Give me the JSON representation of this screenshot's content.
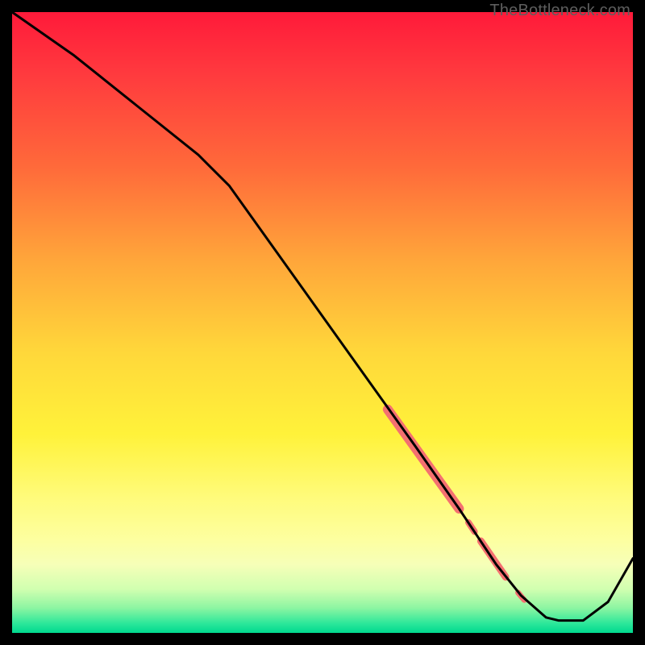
{
  "watermark": "TheBottleneck.com",
  "chart_data": {
    "type": "line",
    "title": "",
    "xlabel": "",
    "ylabel": "",
    "xlim": [
      0,
      100
    ],
    "ylim": [
      0,
      100
    ],
    "gradient_stops": [
      {
        "offset": 0.0,
        "color": "#ff1a3a"
      },
      {
        "offset": 0.1,
        "color": "#ff3a3e"
      },
      {
        "offset": 0.25,
        "color": "#ff6a3a"
      },
      {
        "offset": 0.4,
        "color": "#ffa63a"
      },
      {
        "offset": 0.55,
        "color": "#ffd83a"
      },
      {
        "offset": 0.68,
        "color": "#fff23a"
      },
      {
        "offset": 0.78,
        "color": "#fffb7a"
      },
      {
        "offset": 0.85,
        "color": "#fdffa0"
      },
      {
        "offset": 0.89,
        "color": "#f6ffb8"
      },
      {
        "offset": 0.93,
        "color": "#d0ffb0"
      },
      {
        "offset": 0.96,
        "color": "#8cf5a2"
      },
      {
        "offset": 0.985,
        "color": "#2be79a"
      },
      {
        "offset": 1.0,
        "color": "#00d98f"
      }
    ],
    "series": [
      {
        "name": "main-curve",
        "x": [
          0,
          10,
          20,
          30,
          35,
          45,
          55,
          65,
          72,
          78,
          82,
          86,
          88,
          92,
          96,
          100
        ],
        "y": [
          100,
          93,
          85,
          77,
          72,
          58,
          44,
          30,
          20,
          11,
          6,
          2.5,
          2,
          2,
          5,
          12
        ]
      }
    ],
    "highlight_segments": [
      {
        "x0": 60.5,
        "y0": 36,
        "x1": 72,
        "y1": 20,
        "width": 12
      },
      {
        "x0": 73.5,
        "y0": 17.8,
        "x1": 74.5,
        "y1": 16.3,
        "width": 8
      },
      {
        "x0": 75.5,
        "y0": 14.8,
        "x1": 79.5,
        "y1": 9.0,
        "width": 9
      },
      {
        "x0": 81.5,
        "y0": 6.5,
        "x1": 82.5,
        "y1": 5.3,
        "width": 7
      }
    ],
    "highlight_color": "#f47070"
  }
}
